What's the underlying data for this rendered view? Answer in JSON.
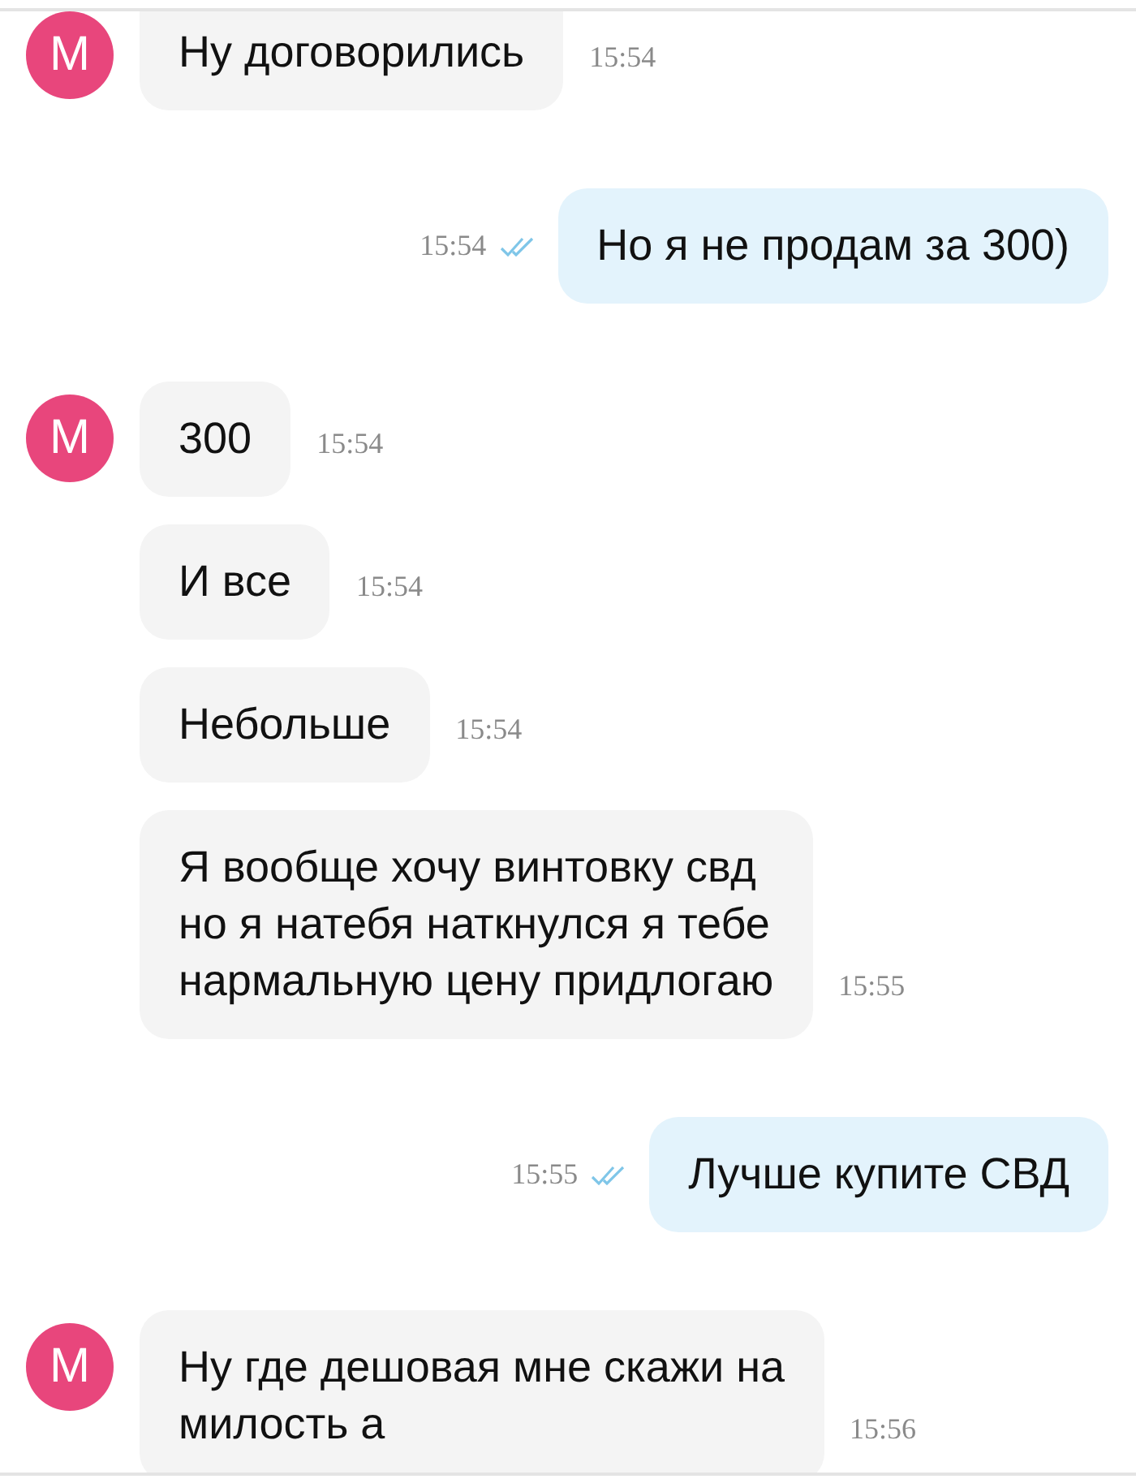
{
  "groups": [
    {
      "kind": "incoming",
      "avatar": "М",
      "messages": [
        {
          "text": "Ну договорились",
          "time": "15:54"
        }
      ]
    },
    {
      "kind": "outgoing",
      "messages": [
        {
          "text": "Но я не продам за 300)",
          "time": "15:54",
          "read": true
        }
      ]
    },
    {
      "kind": "incoming",
      "avatar": "М",
      "messages": [
        {
          "text": "300",
          "time": "15:54"
        },
        {
          "text": "И все",
          "time": "15:54"
        },
        {
          "text": "Небольше",
          "time": "15:54"
        },
        {
          "text": "Я вообще хочу винтовку свд\nно я натебя наткнулся я тебе\nнармальную цену придлогаю",
          "time": "15:55"
        }
      ]
    },
    {
      "kind": "outgoing",
      "messages": [
        {
          "text": "Лучше купите СВД",
          "time": "15:55",
          "read": true
        }
      ]
    },
    {
      "kind": "incoming",
      "avatar": "М",
      "messages": [
        {
          "text": "Ну где дешовая мне скажи на\nмилость а",
          "time": "15:56"
        }
      ]
    }
  ]
}
